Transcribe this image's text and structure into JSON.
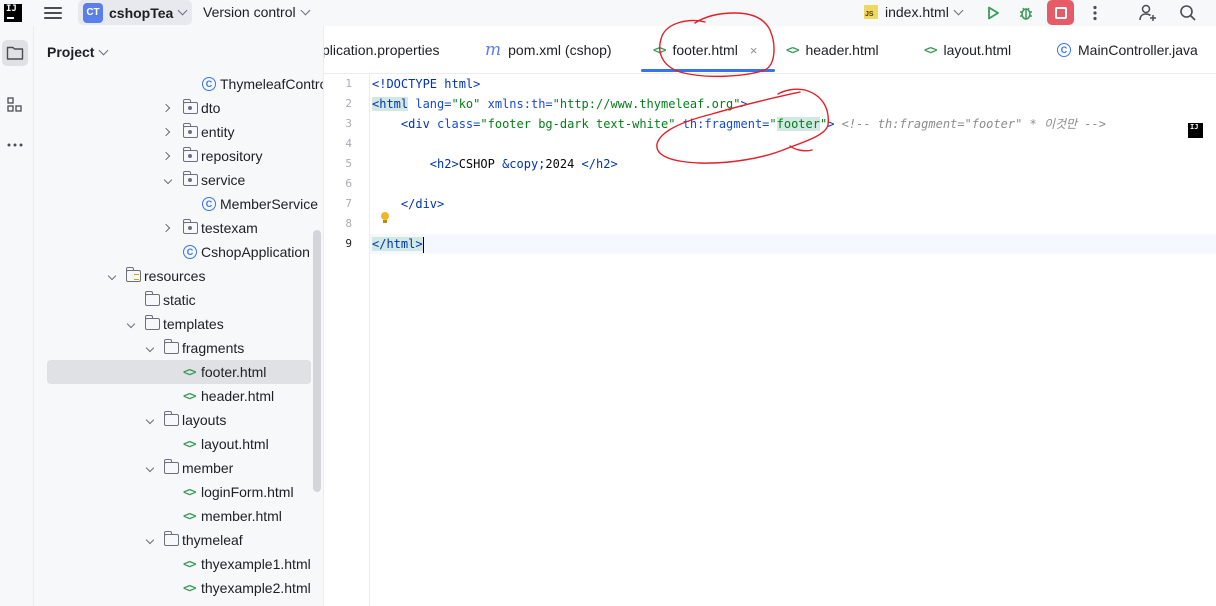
{
  "titlebar": {
    "logo_text": "IJ",
    "project_badge": "CT",
    "project_name": "cshopTea",
    "version_control": "Version control",
    "run_config": "index.html",
    "js_badge": "JS"
  },
  "project_panel": {
    "title": "Project",
    "items": [
      {
        "label": "ThymeleafContro",
        "kind": "class"
      },
      {
        "label": "dto",
        "kind": "package"
      },
      {
        "label": "entity",
        "kind": "package"
      },
      {
        "label": "repository",
        "kind": "package"
      },
      {
        "label": "service",
        "kind": "package"
      },
      {
        "label": "MemberService",
        "kind": "class"
      },
      {
        "label": "testexam",
        "kind": "package"
      },
      {
        "label": "CshopApplication",
        "kind": "class"
      },
      {
        "label": "resources",
        "kind": "resources"
      },
      {
        "label": "static",
        "kind": "folder"
      },
      {
        "label": "templates",
        "kind": "folder"
      },
      {
        "label": "fragments",
        "kind": "folder"
      },
      {
        "label": "footer.html",
        "kind": "html",
        "selected": true
      },
      {
        "label": "header.html",
        "kind": "html"
      },
      {
        "label": "layouts",
        "kind": "folder"
      },
      {
        "label": "layout.html",
        "kind": "html"
      },
      {
        "label": "member",
        "kind": "folder"
      },
      {
        "label": "loginForm.html",
        "kind": "html"
      },
      {
        "label": "member.html",
        "kind": "html"
      },
      {
        "label": "thymeleaf",
        "kind": "folder"
      },
      {
        "label": "thyexample1.html",
        "kind": "html"
      },
      {
        "label": "thyexample2.html",
        "kind": "html"
      }
    ]
  },
  "tabs": [
    {
      "label": "plication.properties",
      "icon": "none"
    },
    {
      "label": "pom.xml (cshop)",
      "icon": "m"
    },
    {
      "label": "footer.html",
      "icon": "html",
      "active": true,
      "close": "×"
    },
    {
      "label": "header.html",
      "icon": "html"
    },
    {
      "label": "layout.html",
      "icon": "html"
    },
    {
      "label": "MainController.java",
      "icon": "class"
    }
  ],
  "icons": {
    "html": "<>",
    "m": "m",
    "class": "C"
  },
  "editor": {
    "line_numbers": [
      "1",
      "2",
      "3",
      "4",
      "5",
      "6",
      "7",
      "8",
      "9"
    ],
    "current_line": "9",
    "lines": {
      "l1": "<!DOCTYPE html>",
      "l2_tag_open": "<html",
      "l2_attr1": " lang=",
      "l2_val1": "\"ko\"",
      "l2_attr2": " xmlns:th=",
      "l2_val2": "\"http://www.thymeleaf.org\"",
      "l2_tag_close": ">",
      "l3_tag_open": "<div",
      "l3_attr1": " class=",
      "l3_val1": "\"footer bg-dark text-white\"",
      "l3_attr2": " th:fragment=",
      "l3_val2_q1": "\"",
      "l3_val2_word": "footer",
      "l3_val2_q2": "\"",
      "l3_tag_close": ">",
      "l3_comment": " <!-- th:fragment=\"footer\" * 이것만 -->",
      "l5_tag_open": "<h2>",
      "l5_text": "CSHOP ",
      "l5_entity": "&copy;",
      "l5_text2": "2024 ",
      "l5_tag_close": "</h2>",
      "l7": "</div>",
      "l9": "</html>"
    }
  },
  "colors": {
    "accent": "#3574f0",
    "stop": "#e55b67",
    "run": "#3a9a5a",
    "annotation": "#e0202a"
  }
}
